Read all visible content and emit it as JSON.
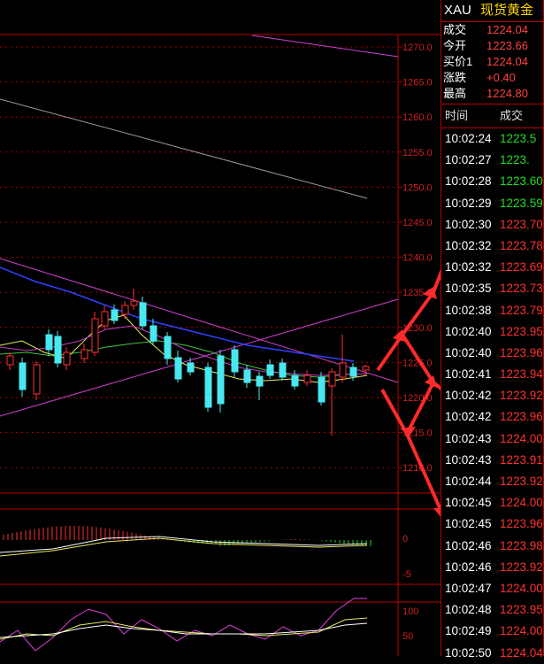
{
  "symbol": "XAU",
  "instrument_name": "现货黄金",
  "quote": [
    {
      "label": "成交",
      "value": "1224.04"
    },
    {
      "label": "今开",
      "value": "1223.66"
    },
    {
      "label": "买价1",
      "value": "1224.04"
    },
    {
      "label": "涨跌",
      "value": "+0.40"
    },
    {
      "label": "最高",
      "value": "1224.80"
    }
  ],
  "ticks_header": {
    "time": "时间",
    "price": "成交"
  },
  "ticks": [
    {
      "time": "10:02:24",
      "price": "1223.5",
      "color": "#22dd22"
    },
    {
      "time": "10:02:27",
      "price": "1223.",
      "color": "#22dd22"
    },
    {
      "time": "10:02:28",
      "price": "1223.60",
      "color": "#22dd22"
    },
    {
      "time": "10:02:29",
      "price": "1223.59",
      "color": "#22dd22"
    },
    {
      "time": "10:02:30",
      "price": "1223.70",
      "color": "#ff3030"
    },
    {
      "time": "10:02:32",
      "price": "1223.78",
      "color": "#ff3030"
    },
    {
      "time": "10:02:32",
      "price": "1223.69",
      "color": "#ff3030"
    },
    {
      "time": "10:02:35",
      "price": "1223.73",
      "color": "#ff3030"
    },
    {
      "time": "10:02:38",
      "price": "1223.79",
      "color": "#ff3030"
    },
    {
      "time": "10:02:40",
      "price": "1223.95",
      "color": "#ff3030"
    },
    {
      "time": "10:02:40",
      "price": "1223.96",
      "color": "#ff3030"
    },
    {
      "time": "10:02:41",
      "price": "1223.94",
      "color": "#ff3030"
    },
    {
      "time": "10:02:42",
      "price": "1223.92",
      "color": "#ff3030"
    },
    {
      "time": "10:02:42",
      "price": "1223.96",
      "color": "#ff3030"
    },
    {
      "time": "10:02:43",
      "price": "1224.00",
      "color": "#ff3030"
    },
    {
      "time": "10:02:43",
      "price": "1223.91",
      "color": "#ff3030"
    },
    {
      "time": "10:02:44",
      "price": "1223.92",
      "color": "#ff3030"
    },
    {
      "time": "10:02:45",
      "price": "1224.00",
      "color": "#ff3030"
    },
    {
      "time": "10:02:45",
      "price": "1223.96",
      "color": "#ff3030"
    },
    {
      "time": "10:02:46",
      "price": "1223.98",
      "color": "#ff3030"
    },
    {
      "time": "10:02:46",
      "price": "1223.92",
      "color": "#ff3030"
    },
    {
      "time": "10:02:47",
      "price": "1224.00",
      "color": "#ff3030"
    },
    {
      "time": "10:02:48",
      "price": "1223.95",
      "color": "#ff3030"
    },
    {
      "time": "10:02:49",
      "price": "1224.00",
      "color": "#ff3030"
    },
    {
      "time": "10:02:50",
      "price": "1224.04",
      "color": "#ff3030"
    }
  ],
  "price_axis_labels": [
    "1270.0",
    "1265.0",
    "1260.0",
    "1255.0",
    "1250.0",
    "1245.0",
    "1240.0",
    "1235.0",
    "1230.0",
    "1225.0",
    "1220.0",
    "1215.0",
    "1210.0"
  ],
  "macd_axis_labels": [
    "0",
    "-5"
  ],
  "kdj_axis_labels": [
    "100",
    "50"
  ],
  "colors": {
    "up": "#ff3030",
    "down": "#22dd22",
    "grid": "#aa0000",
    "axis_text": "#cc2020",
    "arrow": "#ff2a2a"
  }
}
